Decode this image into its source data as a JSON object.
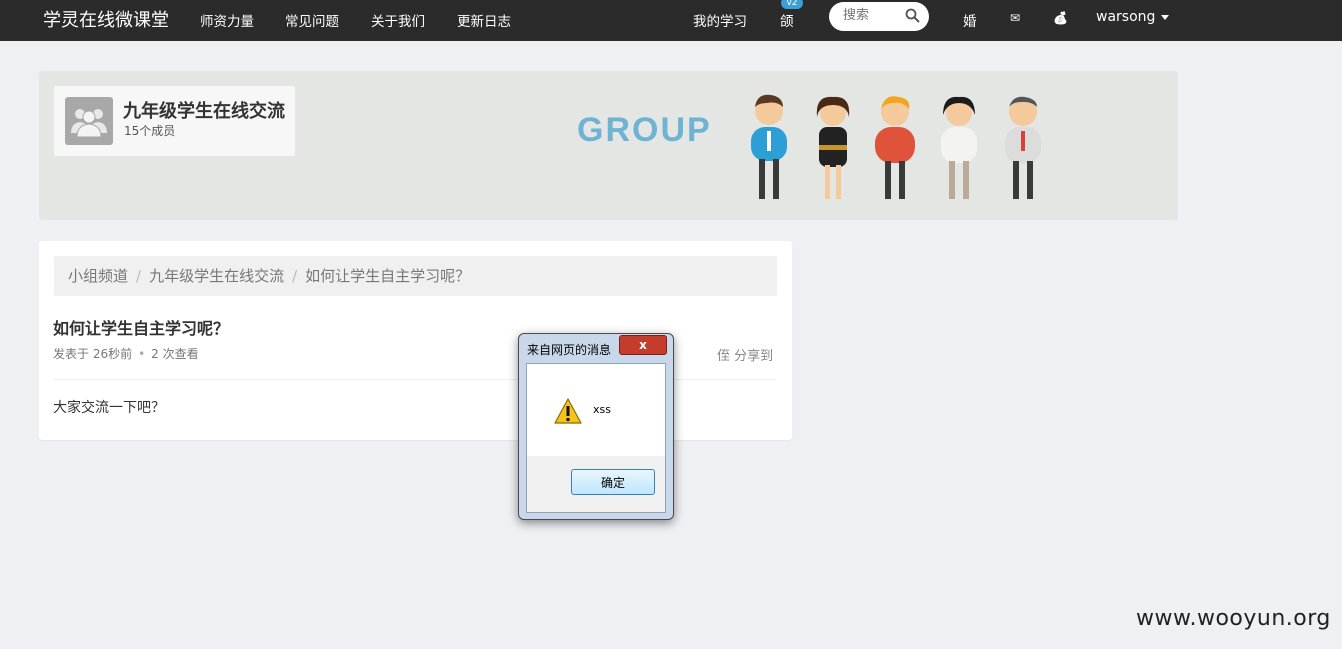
{
  "navbar": {
    "brand": "学灵在线微课堂",
    "links": [
      "师资力量",
      "常见问题",
      "关于我们",
      "更新日志"
    ],
    "my_learning": "我的学习",
    "notify_glyph": "颌",
    "notify_badge": "v2",
    "search_placeholder": "搜索",
    "msg_glyph": "婚",
    "mail_glyph": "✉",
    "coin_glyph": "💰",
    "username": "warsong"
  },
  "group": {
    "name": "九年级学生在线交流",
    "members": "15个成员",
    "banner_text": "GROUP"
  },
  "breadcrumb": [
    "小组频道",
    "九年级学生在线交流",
    "如何让学生自主学习呢？"
  ],
  "post": {
    "title": "如何让学生自主学习呢？",
    "posted": "发表于 26秒前",
    "views": "2 次查看",
    "share_glyph": "侄",
    "share": "分享到",
    "body": "大家交流一下吧？"
  },
  "dialog": {
    "title": "来自网页的消息",
    "close": "x",
    "message": "xss",
    "ok": "确定"
  },
  "watermark": "www.wooyun.org",
  "colors": {
    "topbar": "#2b2b2b",
    "banner": "#e4e6e3",
    "accent": "#3b9fd8",
    "group_text": "#6fb3d2"
  }
}
